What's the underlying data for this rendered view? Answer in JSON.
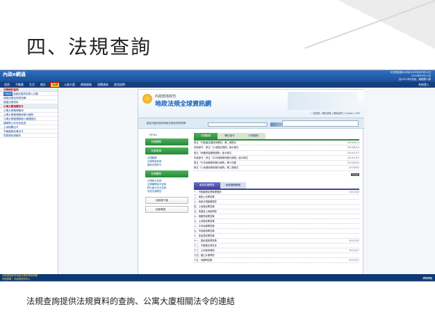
{
  "slide": {
    "title": "四、法規查詢",
    "caption": "法規查詢提供法規資料的查詢、公寓大廈相關法令的連結"
  },
  "app": {
    "logo": "內政e網通",
    "top_info": [
      "今天是民國104年(2015年)09月11日",
      "2015年09月11日",
      "自2011年5月起，總點閱人數"
    ],
    "menu": [
      {
        "label": "首頁",
        "active": false
      },
      {
        "label": "不動產",
        "active": false
      },
      {
        "label": "生活",
        "active": false
      },
      {
        "label": "統計",
        "active": false
      },
      {
        "label": "法規",
        "active": true
      },
      {
        "label": "公寓大廈",
        "active": false
      },
      {
        "label": "網路服務",
        "active": false
      },
      {
        "label": "相關連結",
        "active": false
      },
      {
        "label": "使用說明",
        "active": false
      }
    ],
    "login": "系統登入",
    "sidebar": [
      {
        "tag": "",
        "label": "法規資料查詢",
        "hdr": true
      },
      {
        "tag": "內政部",
        "label": "全國法規資料庫入口網",
        "hdr": false
      },
      {
        "tag": "",
        "label": "地政法規全球資訊網",
        "hdr": false
      },
      {
        "tag": "",
        "label": "營建法規資料",
        "hdr": false
      },
      {
        "tag": "",
        "label": "公寓大廈相關法令",
        "hdr": true
      },
      {
        "tag": "",
        "label": "公寓大廈管理條例",
        "hdr": false
      },
      {
        "tag": "",
        "label": "公寓大廈管理條例施行細則",
        "hdr": false
      },
      {
        "tag": "",
        "label": "公寓大廈管理服務人管理辦法",
        "hdr": false
      },
      {
        "tag": "",
        "label": "建築物公共安全檢查",
        "hdr": false
      },
      {
        "tag": "",
        "label": "土地相關法令",
        "hdr": false
      },
      {
        "tag": "",
        "label": "不動產經紀業法令",
        "hdr": false
      },
      {
        "tag": "",
        "label": "買賣契約書範本",
        "hdr": false
      }
    ],
    "footer_lines": [
      "內政部地政司地政法規全球資訊網",
      "系統建置：內政部資訊中心"
    ],
    "status": "網際網路"
  },
  "site": {
    "subtitle": "內政部地政司",
    "name": "地政法規全球資訊網",
    "links": "::: 回首頁 | 網站導覽 | 聯絡我們 | English | RSS",
    "search_label": "歡迎光臨內政部地政法規全球資訊網",
    "menu_label": "MENU",
    "menu_buttons": [
      "法規動態",
      "法規查詢",
      "法規體系"
    ],
    "lists": [
      [
        "法規輯要",
        "法律草案查詢",
        "最新法規命令"
      ],
      [
        "法規條文查詢",
        "法規解釋函令查詢",
        "釋示函令全文查詢",
        "常見法規問答"
      ]
    ],
    "img_buttons": [
      "地政電子報",
      "地政專區"
    ],
    "tabs": [
      "法規動態",
      "釋示函令",
      "行政規則"
    ],
    "news": [
      {
        "t": "修正「不動產估價技術規則」第二條條文",
        "d": "2015/8/14"
      },
      {
        "t": "內政部令：修正「土地登記規則」部分條文",
        "d": "2015/8/14"
      },
      {
        "t": "修正「地籍測量實施規則」部分條文",
        "d": "2015/7/27"
      },
      {
        "t": "內政部令：修正「平均地權條例施行細則」部分條文",
        "d": "2015/7/15"
      },
      {
        "t": "修正「平均地權條例施行細則」第十四條",
        "d": "2015/6/25"
      },
      {
        "t": "修正「土地徵收條例施行細則」第二條條文",
        "d": "2015/6/2"
      }
    ],
    "tabs2": [
      "常見法規問答",
      "地政機關業務"
    ],
    "news2": [
      {
        "t": "一、不動產經紀業管理條例",
        "d": "2015/3/2"
      },
      {
        "t": "二、地政士法問答集",
        "d": ""
      },
      {
        "t": "三、地政法規疑義問答",
        "d": ""
      },
      {
        "t": "四、土地登記問答集",
        "d": ""
      },
      {
        "t": "五、地價及土地稅問答",
        "d": ""
      },
      {
        "t": "六、地籍測量問答集",
        "d": ""
      },
      {
        "t": "七、土地徵收問答集",
        "d": ""
      },
      {
        "t": "八、平均地權問答集",
        "d": ""
      },
      {
        "t": "九、市地重劃問答集",
        "d": ""
      },
      {
        "t": "十、區段徵收問答集",
        "d": ""
      },
      {
        "t": "十一、農地重劃問答集",
        "d": "2015/3/2"
      },
      {
        "t": "十二、不動產交易安全",
        "d": ""
      },
      {
        "t": "十三、土地使用管制",
        "d": "2015/1/7"
      },
      {
        "t": "十四、國土計畫問答",
        "d": ""
      },
      {
        "t": "十五、地權問答集",
        "d": "2015/1/7"
      }
    ],
    "more": "more"
  }
}
